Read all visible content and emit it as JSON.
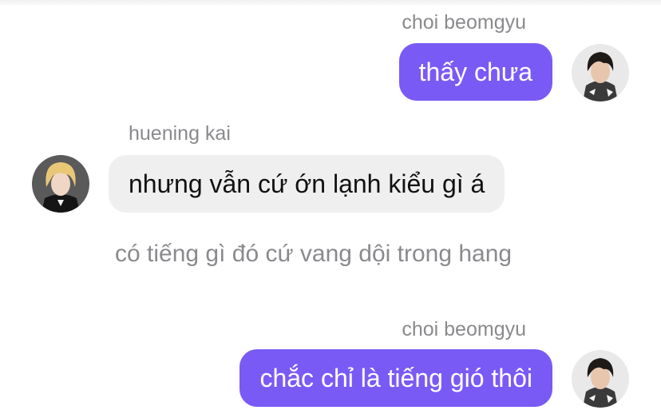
{
  "messages": [
    {
      "sender": "choi beomgyu",
      "text": "thấy chưa",
      "direction": "outgoing"
    },
    {
      "sender": "huening kai",
      "text": "nhưng vẫn cứ ớn lạnh kiểu gì á",
      "direction": "incoming"
    },
    {
      "narration": "có tiếng gì đó cứ vang dội trong hang"
    },
    {
      "sender": "choi beomgyu",
      "text": "chắc chỉ là tiếng gió thôi",
      "direction": "outgoing"
    }
  ],
  "colors": {
    "outgoing_bubble": "#7a5af5",
    "incoming_bubble": "#efefef",
    "meta_text": "#8a8a8e"
  }
}
